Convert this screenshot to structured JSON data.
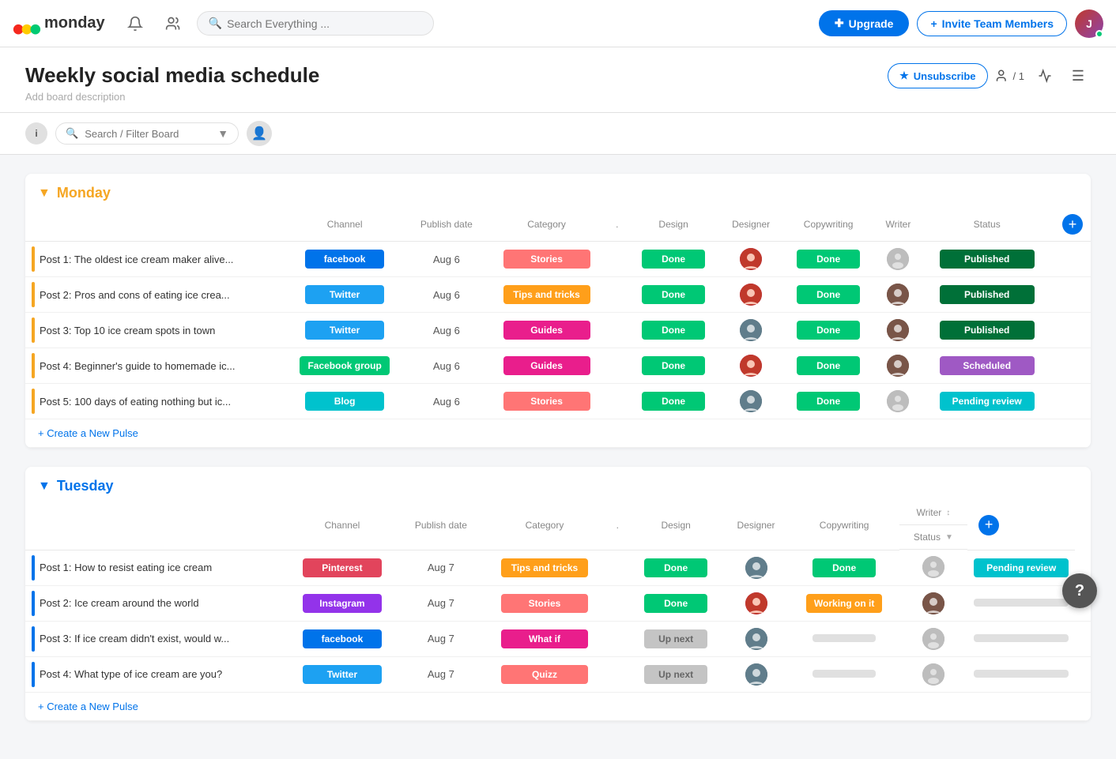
{
  "header": {
    "logo_text": "monday",
    "search_placeholder": "Search Everything ...",
    "upgrade_label": "Upgrade",
    "invite_label": "Invite Team Members"
  },
  "board": {
    "title": "Weekly social media schedule",
    "description": "Add board description",
    "unsubscribe_label": "Unsubscribe",
    "team_count": "/ 1",
    "search_filter_placeholder": "Search / Filter Board"
  },
  "groups": [
    {
      "id": "monday",
      "title": "Monday",
      "color": "#f5a623",
      "columns": [
        "Channel",
        "Publish date",
        "Category",
        ".",
        "Design",
        "Designer",
        "Copywriting",
        "Writer",
        "Status"
      ],
      "rows": [
        {
          "title": "Post 1: The oldest ice cream maker alive...",
          "channel": "facebook",
          "channel_class": "ch-facebook",
          "date": "Aug 6",
          "category": "Stories",
          "category_class": "cat-stories",
          "design": "Done",
          "design_class": "design-done",
          "designer": "av-1",
          "copywriting": "Done",
          "copy_class": "copy-done",
          "writer": "av-cat",
          "status": "Published",
          "status_class": "status-published"
        },
        {
          "title": "Post 2: Pros and cons of eating ice crea...",
          "channel": "Twitter",
          "channel_class": "ch-twitter",
          "date": "Aug 6",
          "category": "Tips and tricks",
          "category_class": "cat-tips",
          "design": "Done",
          "design_class": "design-done",
          "designer": "av-1",
          "copywriting": "Done",
          "copy_class": "copy-done",
          "writer": "av-3",
          "status": "Published",
          "status_class": "status-published"
        },
        {
          "title": "Post 3: Top 10 ice cream spots in town",
          "channel": "Twitter",
          "channel_class": "ch-twitter",
          "date": "Aug 6",
          "category": "Guides",
          "category_class": "cat-guides",
          "design": "Done",
          "design_class": "design-done",
          "designer": "av-2",
          "copywriting": "Done",
          "copy_class": "copy-done",
          "writer": "av-3",
          "status": "Published",
          "status_class": "status-published"
        },
        {
          "title": "Post 4: Beginner's guide to homemade ic...",
          "channel": "Facebook group",
          "channel_class": "ch-facebook-group",
          "date": "Aug 6",
          "category": "Guides",
          "category_class": "cat-guides",
          "design": "Done",
          "design_class": "design-done",
          "designer": "av-1",
          "copywriting": "Done",
          "copy_class": "copy-done",
          "writer": "av-3",
          "status": "Scheduled",
          "status_class": "status-scheduled"
        },
        {
          "title": "Post 5: 100 days of eating nothing but ic...",
          "channel": "Blog",
          "channel_class": "ch-blog",
          "date": "Aug 6",
          "category": "Stories",
          "category_class": "cat-stories",
          "design": "Done",
          "design_class": "design-done",
          "designer": "av-2",
          "copywriting": "Done",
          "copy_class": "copy-done",
          "writer": "av-cat",
          "status": "Pending review",
          "status_class": "status-pending"
        }
      ],
      "create_label": "+ Create a New Pulse"
    },
    {
      "id": "tuesday",
      "title": "Tuesday",
      "color": "#0073ea",
      "columns": [
        "Channel",
        "Publish date",
        "Category",
        ".",
        "Design",
        "Designer",
        "Copywriting",
        "Writer",
        "Status"
      ],
      "rows": [
        {
          "title": "Post 1: How to resist eating ice cream",
          "channel": "Pinterest",
          "channel_class": "ch-pinterest",
          "date": "Aug 7",
          "category": "Tips and tricks",
          "category_class": "cat-tips",
          "design": "Done",
          "design_class": "design-done",
          "designer": "av-2",
          "copywriting": "Done",
          "copy_class": "copy-done",
          "writer": "av-cat",
          "status": "Pending review",
          "status_class": "status-pending"
        },
        {
          "title": "Post 2: Ice cream around the world",
          "channel": "Instagram",
          "channel_class": "ch-instagram",
          "date": "Aug 7",
          "category": "Stories",
          "category_class": "cat-stories",
          "design": "Done",
          "design_class": "design-done",
          "designer": "av-1",
          "copywriting": "Working on it",
          "copy_class": "copy-working",
          "writer": "av-3",
          "status": "",
          "status_class": "status-empty"
        },
        {
          "title": "Post 3: If ice cream didn't exist, would w...",
          "channel": "facebook",
          "channel_class": "ch-facebook",
          "date": "Aug 7",
          "category": "What if",
          "category_class": "cat-whatif",
          "design": "Up next",
          "design_class": "design-upnext",
          "designer": "av-2",
          "copywriting": "",
          "copy_class": "copy-empty",
          "writer": "av-cat",
          "status": "",
          "status_class": "status-empty"
        },
        {
          "title": "Post 4: What type of ice cream are you?",
          "channel": "Twitter",
          "channel_class": "ch-twitter",
          "date": "Aug 7",
          "category": "Quizz",
          "category_class": "cat-quizz",
          "design": "Up next",
          "design_class": "design-upnext",
          "designer": "av-2",
          "copywriting": "",
          "copy_class": "copy-empty",
          "writer": "av-cat",
          "status": "",
          "status_class": "status-empty"
        }
      ],
      "create_label": "+ Create a New Pulse"
    }
  ],
  "help": "?"
}
